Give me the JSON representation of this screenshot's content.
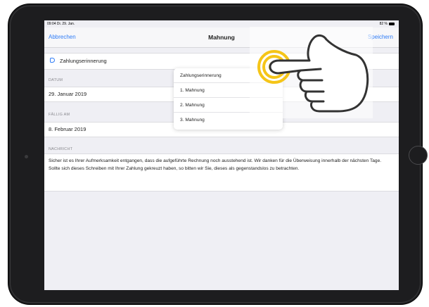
{
  "statusbar": {
    "time": "09:04  Di. 29. Jan.",
    "battery": "82 %"
  },
  "navbar": {
    "cancel": "Abbrechen",
    "title": "Mahnung",
    "save": "Speichern"
  },
  "type_field": {
    "value": "Zahlungserinnerung"
  },
  "date_section": {
    "header": "DATUM",
    "value": "29. Januar 2019"
  },
  "due_section": {
    "header": "FÄLLIG AM",
    "value": "8. Februar 2019"
  },
  "message_section": {
    "header": "NACHRICHT",
    "text": "Sicher ist es Ihrer Aufmerksamkeit entgangen, dass die aufgeführte Rechnung noch ausstehend ist. Wir danken für die Überweisung innerhalb der nächsten Tage. Sollte sich dieses Schreiben mit Ihrer Zahlung gekreuzt haben, so bitten wir Sie, dieses als gegenstandslos zu betrachten."
  },
  "popover": {
    "options": [
      "Zahlungserinnerung",
      "1. Mahnung",
      "2. Mahnung",
      "3. Mahnung"
    ]
  },
  "colors": {
    "accent": "#2f7cf6",
    "tap_highlight": "#f5c518"
  },
  "icons": {
    "tap_gesture": "pointing-hand-icon",
    "type_marker": "tag-icon"
  }
}
